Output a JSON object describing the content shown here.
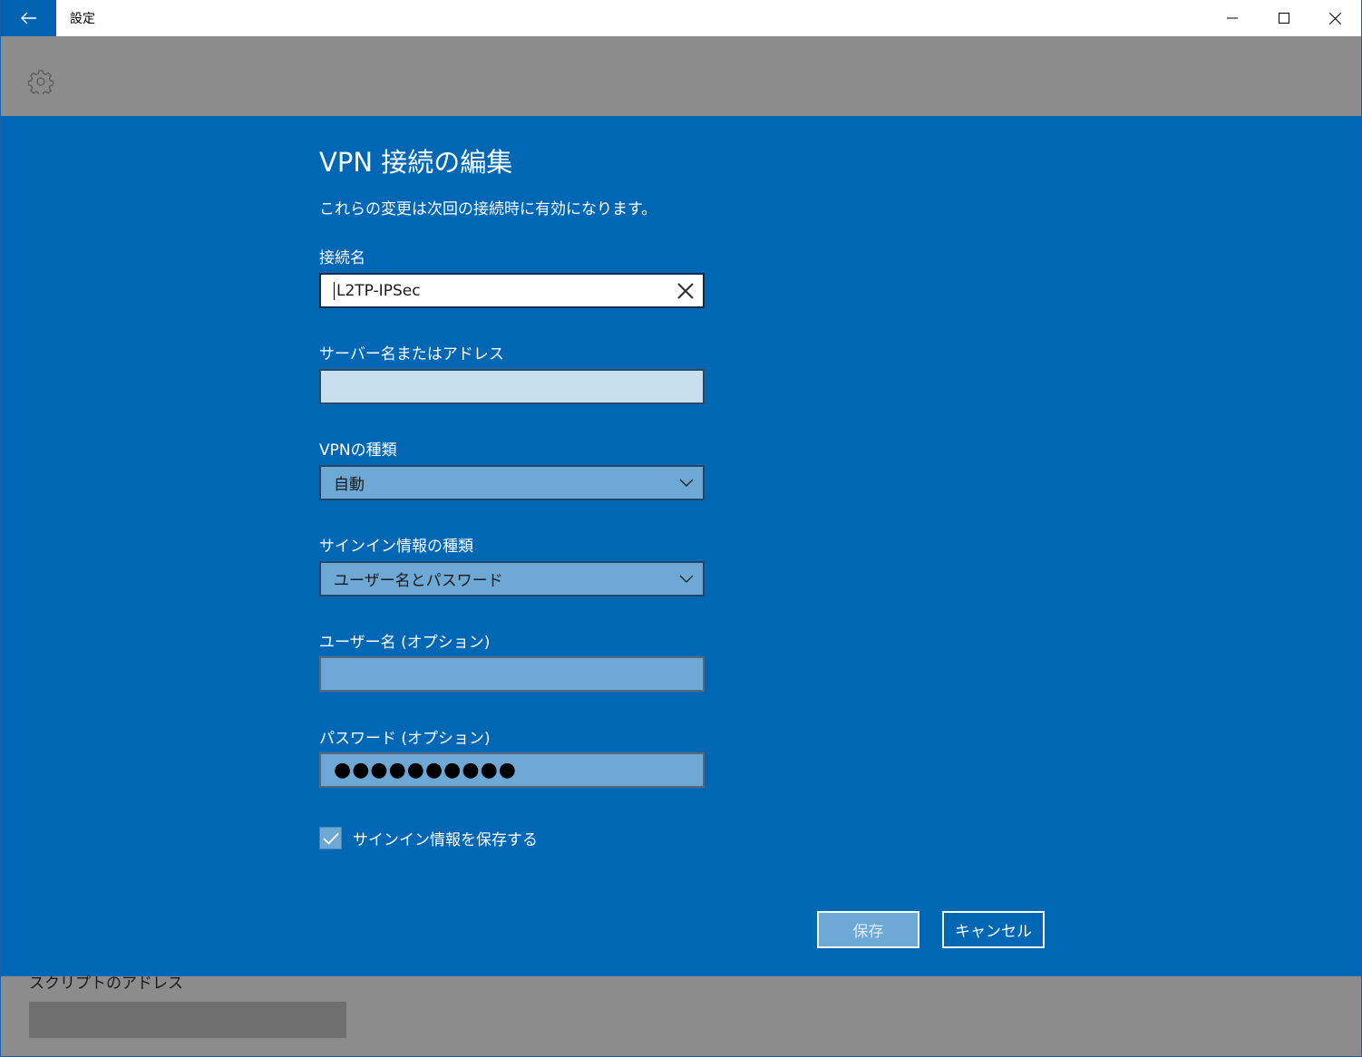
{
  "window": {
    "title": "設定",
    "controls": {
      "minimize": "—",
      "maximize": "☐",
      "close": "✕"
    }
  },
  "dialog": {
    "title": "VPN 接続の編集",
    "subtitle": "これらの変更は次回の接続時に有効になります。",
    "fields": {
      "connection_name": {
        "label": "接続名",
        "value": "L2TP-IPSec"
      },
      "server": {
        "label": "サーバー名またはアドレス",
        "value": ""
      },
      "vpn_type": {
        "label": "VPNの種類",
        "value": "自動"
      },
      "signin_type": {
        "label": "サインイン情報の種類",
        "value": "ユーザー名とパスワード"
      },
      "username": {
        "label": "ユーザー名 (オプション)",
        "value": ""
      },
      "password": {
        "label": "パスワード (オプション)",
        "value": "●●●●●●●●●●"
      }
    },
    "remember": {
      "label": "サインイン情報を保存する",
      "checked": true
    },
    "buttons": {
      "save": "保存",
      "cancel": "キャンセル"
    }
  },
  "background": {
    "script_address_label": "スクリプトのアドレス"
  },
  "colors": {
    "accent": "#0067b4",
    "titlebar_back": "#0063b1",
    "input_fill": "#6ea8d5"
  }
}
